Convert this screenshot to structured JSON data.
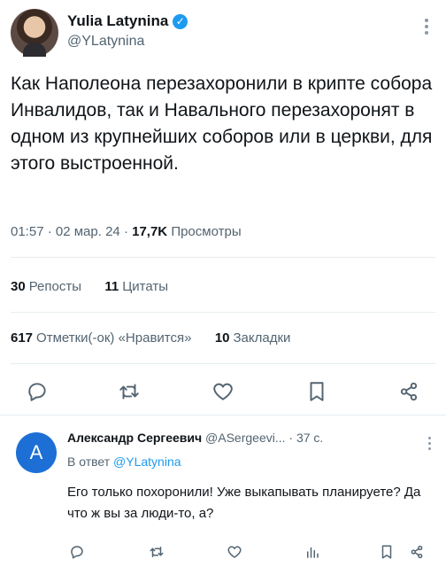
{
  "tweet": {
    "author_name": "Yulia Latynina",
    "author_handle": "@YLatynina",
    "text": "Как Наполеона перезахоронили в крипте собора Инвалидов, так и Навального перезахоронят в одном из крупнейших соборов или в церкви, для этого выстроенной.",
    "time": "01:57",
    "date": "02 мар. 24",
    "views_count": "17,7K",
    "views_label": "Просмотры",
    "reposts_count": "30",
    "reposts_label": "Репосты",
    "quotes_count": "11",
    "quotes_label": "Цитаты",
    "likes_count": "617",
    "likes_label": "Отметки(-ок) «Нравится»",
    "bookmarks_count": "10",
    "bookmarks_label": "Закладки",
    "verified_color": "#1d9bf0",
    "sep": "·"
  },
  "reply": {
    "avatar_letter": "A",
    "avatar_color": "#1d6fd6",
    "author_name": "Александр Сергеевич",
    "author_handle": "@ASergeevi...",
    "time": "· 37 с.",
    "reply_to_prefix": "В ответ",
    "reply_to_handle": "@YLatynina",
    "text": "Его только похоронили! Уже выкапывать планируете? Да что ж вы за люди-то, а?"
  },
  "icons": [
    "reply-icon",
    "retweet-icon",
    "like-icon",
    "bookmark-icon",
    "share-icon",
    "views-icon",
    "more-icon",
    "verified-icon"
  ],
  "colors": {
    "accent": "#1d9bf0",
    "muted": "#536471",
    "text": "#0f1419"
  }
}
